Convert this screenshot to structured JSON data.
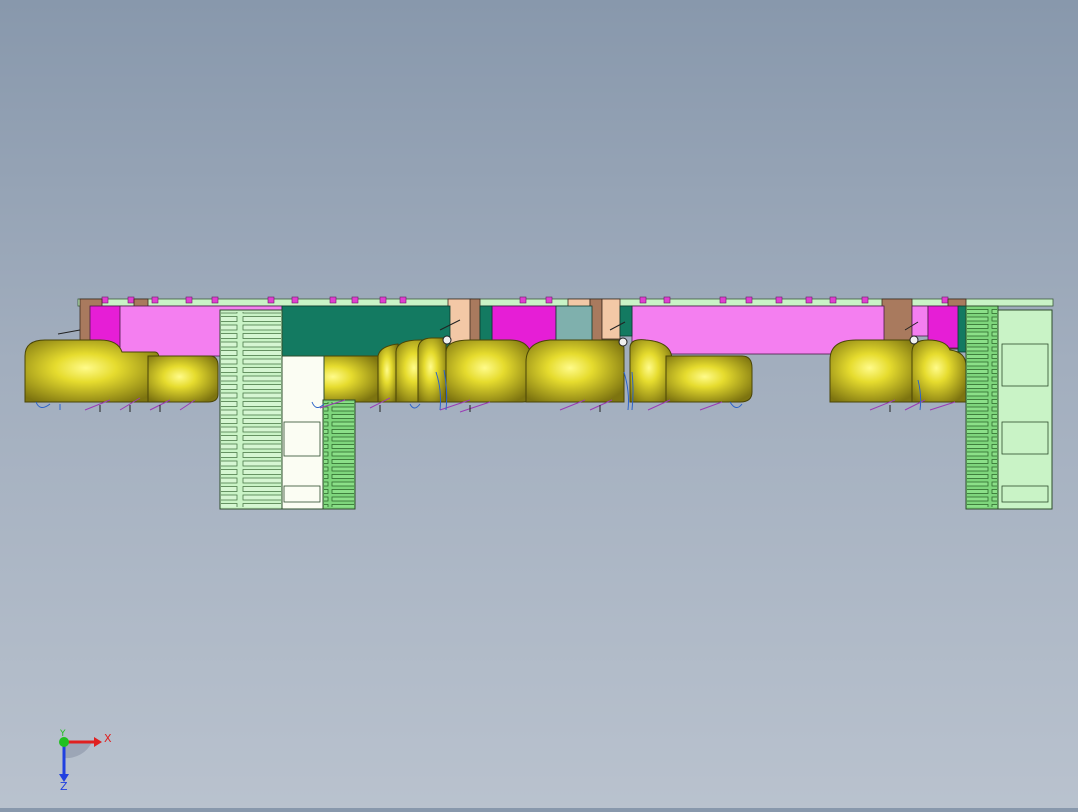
{
  "viewport": {
    "background_top": "#8898ac",
    "background_bottom": "#b9c2ce",
    "colors": {
      "pink": "#f47ff0",
      "magenta": "#e61ed6",
      "teal": "#137a61",
      "yellow": "#c9c21a",
      "light_green": "#c9f3c6",
      "green": "#7ed67c",
      "brown": "#a97a5e",
      "salmon": "#f3c8a6",
      "blue": "#2c64c8",
      "purple": "#9b3bb5"
    }
  },
  "triad": {
    "x_label": "X",
    "y_label": "Y",
    "z_label": "Z",
    "x_color": "#e02020",
    "y_color": "#20c020",
    "z_color": "#2040e0"
  }
}
